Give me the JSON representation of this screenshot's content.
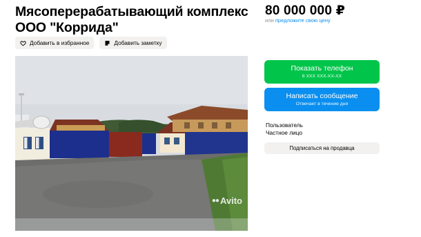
{
  "listing": {
    "title": "Мясоперерабатывающий комплекс ООО \"Коррида\""
  },
  "actions": {
    "favorite_label": "Добавить в избранное",
    "note_label": "Добавить заметку"
  },
  "price": {
    "value": "80 000 000 ₽",
    "or_text": "или ",
    "offer_link": "предложите свою цену"
  },
  "contact": {
    "phone_label": "Показать телефон",
    "phone_masked": "8 XXX XXX-XX-XX",
    "message_label": "Написать сообщение",
    "message_sub": "Отвечает в течение дня"
  },
  "seller": {
    "label": "Пользователь",
    "type": "Частное лицо",
    "subscribe_label": "Подписаться на продавца"
  },
  "photo": {
    "watermark": "Avito"
  },
  "colors": {
    "phone_button": "#00c54a",
    "message_button": "#0a8ff0",
    "link": "#0a8ff0"
  }
}
